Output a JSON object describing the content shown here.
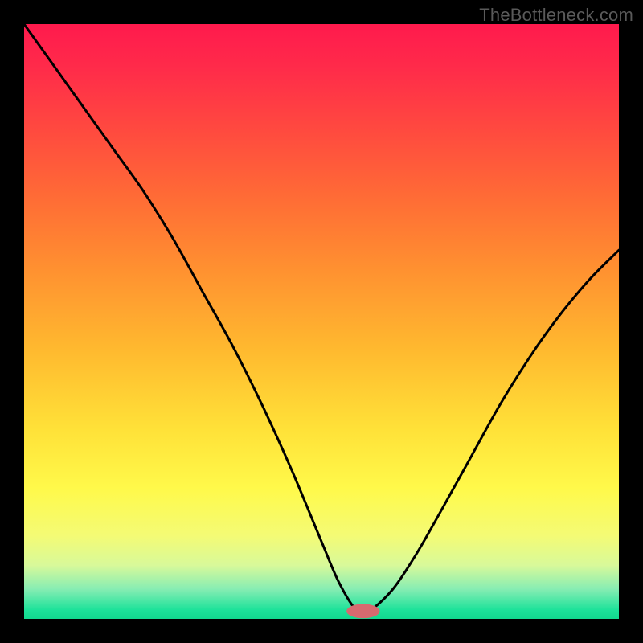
{
  "attribution": "TheBottleneck.com",
  "chart_data": {
    "type": "line",
    "title": "",
    "xlabel": "",
    "ylabel": "",
    "xlim": [
      0,
      1
    ],
    "ylim": [
      0,
      1
    ],
    "series": [
      {
        "name": "curve",
        "x": [
          0.0,
          0.05,
          0.1,
          0.15,
          0.2,
          0.25,
          0.3,
          0.35,
          0.4,
          0.45,
          0.5,
          0.53,
          0.56,
          0.58,
          0.62,
          0.66,
          0.7,
          0.75,
          0.8,
          0.85,
          0.9,
          0.95,
          1.0
        ],
        "y": [
          1.0,
          0.93,
          0.86,
          0.79,
          0.72,
          0.64,
          0.55,
          0.46,
          0.36,
          0.25,
          0.13,
          0.06,
          0.013,
          0.013,
          0.05,
          0.11,
          0.18,
          0.27,
          0.36,
          0.44,
          0.51,
          0.57,
          0.62
        ]
      }
    ],
    "marker": {
      "x": 0.57,
      "y": 0.013,
      "rx": 0.028,
      "ry": 0.012,
      "color": "#d66a6f"
    },
    "gradient_stops": [
      {
        "offset": 0.0,
        "color": "#ff1a4d"
      },
      {
        "offset": 0.07,
        "color": "#ff2a4a"
      },
      {
        "offset": 0.18,
        "color": "#ff4a3f"
      },
      {
        "offset": 0.3,
        "color": "#ff6e35"
      },
      {
        "offset": 0.42,
        "color": "#ff9330"
      },
      {
        "offset": 0.55,
        "color": "#ffba2f"
      },
      {
        "offset": 0.68,
        "color": "#ffe138"
      },
      {
        "offset": 0.78,
        "color": "#fff94a"
      },
      {
        "offset": 0.86,
        "color": "#f4fb75"
      },
      {
        "offset": 0.91,
        "color": "#d8f99a"
      },
      {
        "offset": 0.95,
        "color": "#86edb3"
      },
      {
        "offset": 0.985,
        "color": "#1de29a"
      },
      {
        "offset": 1.0,
        "color": "#12d98f"
      }
    ],
    "grid": false,
    "legend": false
  }
}
